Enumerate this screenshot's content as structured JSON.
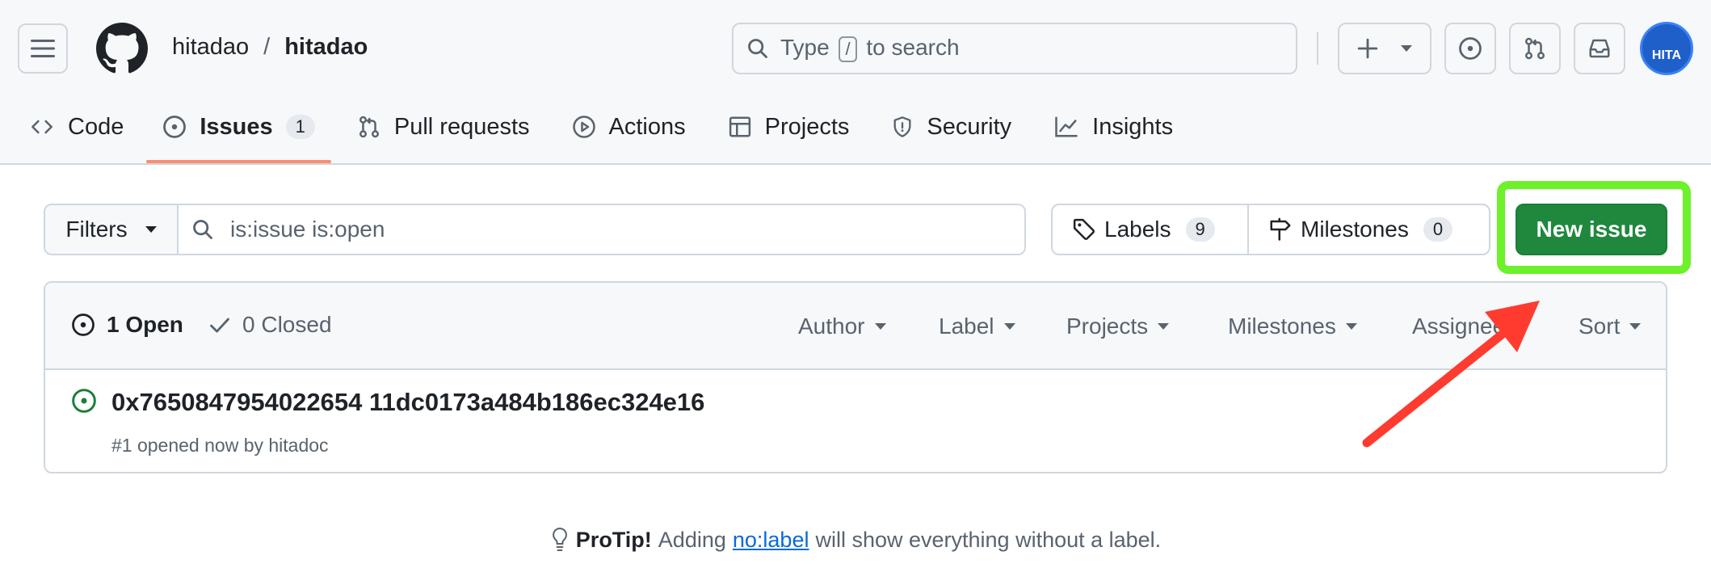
{
  "header": {
    "owner": "hitadao",
    "separator": "/",
    "repo": "hitadao",
    "search_prefix": "Type",
    "search_key": "/",
    "search_suffix": "to search",
    "avatar_text": "HITA"
  },
  "tabs": [
    {
      "label": "Code",
      "icon": "code-icon"
    },
    {
      "label": "Issues",
      "icon": "issue-opened-icon",
      "count": "1",
      "selected": true
    },
    {
      "label": "Pull requests",
      "icon": "git-pull-request-icon"
    },
    {
      "label": "Actions",
      "icon": "play-icon"
    },
    {
      "label": "Projects",
      "icon": "table-icon"
    },
    {
      "label": "Security",
      "icon": "shield-icon"
    },
    {
      "label": "Insights",
      "icon": "graph-icon"
    }
  ],
  "filters": {
    "button_label": "Filters",
    "query": "is:issue is:open"
  },
  "labels": {
    "label": "Labels",
    "count": "9"
  },
  "milestones": {
    "label": "Milestones",
    "count": "0"
  },
  "new_issue_label": "New issue",
  "list": {
    "open_label": "1 Open",
    "closed_label": "0 Closed",
    "selectors": [
      "Author",
      "Label",
      "Projects",
      "Milestones",
      "Assignee",
      "Sort"
    ]
  },
  "issues": [
    {
      "title": "0x7650847954022654 11dc0173a484b186ec324e16",
      "meta": "#1 opened now by hitadoc"
    }
  ],
  "protip": {
    "bold": "ProTip!",
    "before": "Adding",
    "link": "no:label",
    "after": "will show everything without a label."
  },
  "colors": {
    "accent_green": "#1f883d",
    "highlight": "#6cf12a",
    "arrow": "#ff3b30",
    "tab_underline": "#fd8c73"
  }
}
